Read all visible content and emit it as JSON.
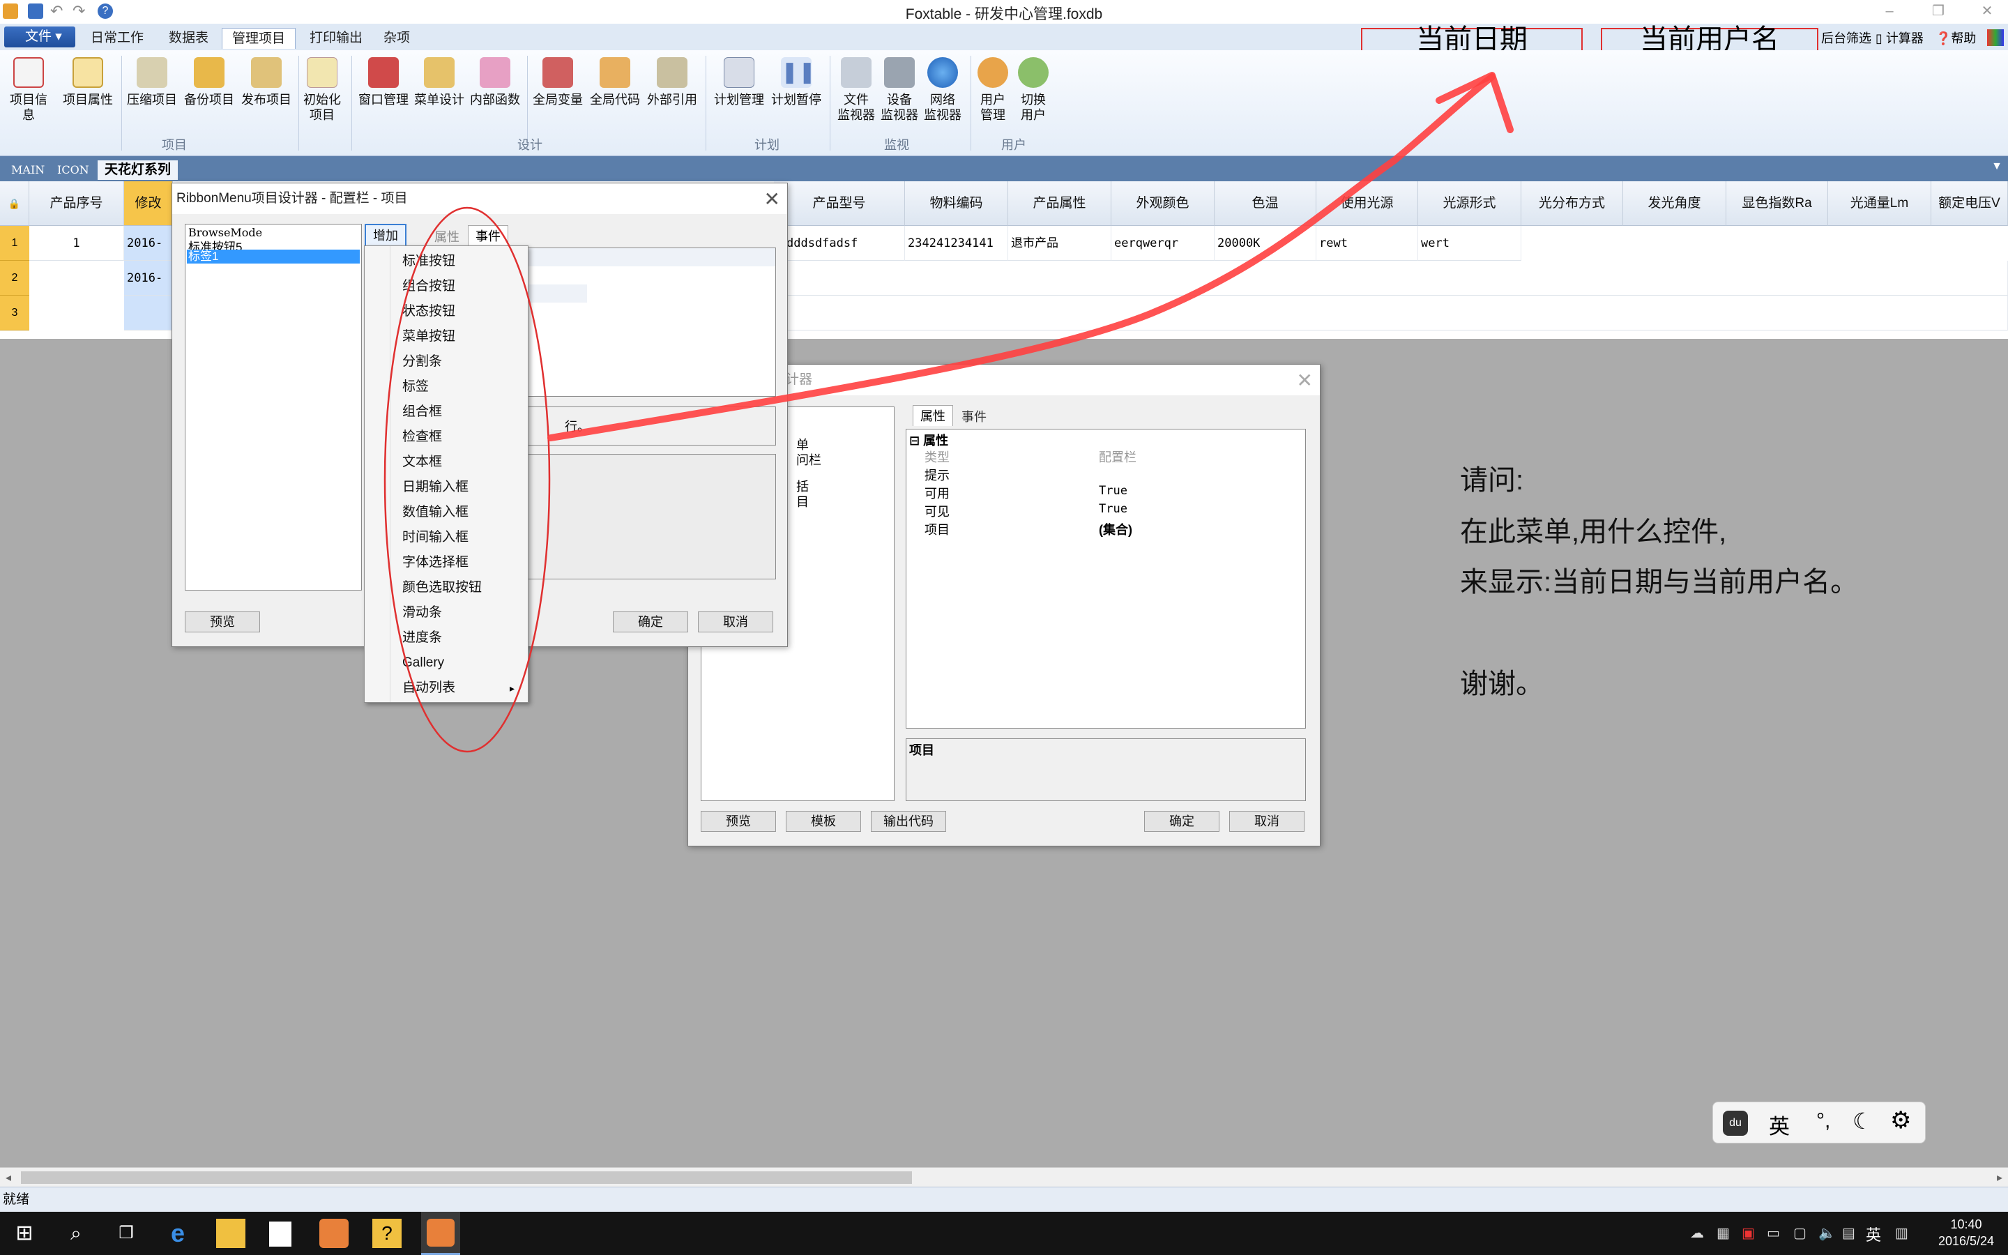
{
  "window": {
    "title": "Foxtable - 研发中心管理.foxdb"
  },
  "ribbon_tabs": [
    {
      "label": "文件"
    },
    {
      "label": "日常工作"
    },
    {
      "label": "数据表"
    },
    {
      "label": "管理项目"
    },
    {
      "label": "打印输出"
    },
    {
      "label": "杂项"
    }
  ],
  "top_right": {
    "filter": "后台筛选",
    "calculator": "计算器",
    "help": "帮助"
  },
  "annotation_boxes": {
    "date": "当前日期",
    "user": "当前用户名"
  },
  "ribbon": {
    "buttons": [
      {
        "l1": "项目信息",
        "l2": ""
      },
      {
        "l1": "项目属性",
        "l2": ""
      },
      {
        "l1": "压缩项目",
        "l2": ""
      },
      {
        "l1": "备份项目",
        "l2": ""
      },
      {
        "l1": "发布项目",
        "l2": ""
      },
      {
        "l1": "初始化",
        "l2": "项目"
      },
      {
        "l1": "窗口管理",
        "l2": ""
      },
      {
        "l1": "菜单设计",
        "l2": ""
      },
      {
        "l1": "内部函数",
        "l2": ""
      },
      {
        "l1": "全局变量",
        "l2": ""
      },
      {
        "l1": "全局代码",
        "l2": ""
      },
      {
        "l1": "外部引用",
        "l2": ""
      },
      {
        "l1": "计划管理",
        "l2": ""
      },
      {
        "l1": "计划暂停",
        "l2": ""
      },
      {
        "l1": "文件",
        "l2": "监视器"
      },
      {
        "l1": "设备",
        "l2": "监视器"
      },
      {
        "l1": "网络",
        "l2": "监视器"
      },
      {
        "l1": "用户",
        "l2": "管理"
      },
      {
        "l1": "切换",
        "l2": "用户"
      }
    ],
    "groups": [
      "项目",
      "设计",
      "计划",
      "监视",
      "用户"
    ]
  },
  "doc_tabs": [
    "MAIN",
    "ICON",
    "天花灯系列"
  ],
  "grid": {
    "headers": [
      "产品序号",
      "修改",
      "产品型号",
      "物料编码",
      "产品属性",
      "外观颜色",
      "色温",
      "使用光源",
      "光源形式",
      "光分布方式",
      "发光角度",
      "显色指数Ra",
      "光通量Lm",
      "额定电压V"
    ],
    "rows": [
      {
        "num": "1",
        "seq": "1",
        "mod": "2016-",
        "model": "dddsdfadsf",
        "code": "234241234141",
        "attr": "退市产品",
        "color": "eerqwerqr",
        "temp": "20000K",
        "light": "rewt",
        "form": "wert"
      },
      {
        "num": "2",
        "seq": "",
        "mod": "2016-",
        "model": "",
        "code": "",
        "attr": "",
        "color": "",
        "temp": "",
        "light": "",
        "form": ""
      },
      {
        "num": "3",
        "seq": "",
        "mod": "",
        "model": "",
        "code": "",
        "attr": "",
        "color": "",
        "temp": "",
        "light": "",
        "form": ""
      }
    ]
  },
  "dialog1": {
    "title": "RibbonMenu项目设计器 - 配置栏 - 项目",
    "list": [
      "BrowseMode",
      "标准按钮5",
      "标签1"
    ],
    "add": "增加",
    "tabs": [
      "属性",
      "事件"
    ],
    "partial_text": "行。",
    "preview": "预览",
    "ok": "确定",
    "cancel": "取消"
  },
  "menu": [
    "标准按钮",
    "组合按钮",
    "状态按钮",
    "菜单按钮",
    "分割条",
    "标签",
    "组合框",
    "检查框",
    "文本框",
    "日期输入框",
    "数值输入框",
    "时间输入框",
    "字体选择框",
    "颜色选取按钮",
    "滑动条",
    "进度条",
    "Gallery",
    "自动列表"
  ],
  "dialog2": {
    "title_partial": "计器",
    "list_partial": [
      "单",
      "问栏",
      "括",
      "目"
    ],
    "tabs": [
      "属性",
      "事件"
    ],
    "prop_group": "属性",
    "props": [
      {
        "name": "类型",
        "value": "配置栏"
      },
      {
        "name": "提示",
        "value": ""
      },
      {
        "name": "可用",
        "value": "True"
      },
      {
        "name": "可见",
        "value": "True"
      },
      {
        "name": "项目",
        "value": "(集合)"
      }
    ],
    "desc_title": "项目",
    "preview": "预览",
    "template": "模板",
    "export": "输出代码",
    "ok": "确定",
    "cancel": "取消"
  },
  "question": {
    "line1": "请问:",
    "line2": "在此菜单,用什么控件,",
    "line3": "来显示:当前日期与当前用户名。",
    "line4": "谢谢。"
  },
  "ime": {
    "mode": "英"
  },
  "status": {
    "text": "就绪"
  },
  "taskbar": {
    "time": "10:40",
    "date": "2016/5/24",
    "ime": "英"
  },
  "colors": {
    "ribbon_bg": "#dfe9f5",
    "row_header": "#f6c54a",
    "selection": "#3399ff",
    "annotation_red": "#e03030",
    "workspace": "#ababab"
  }
}
